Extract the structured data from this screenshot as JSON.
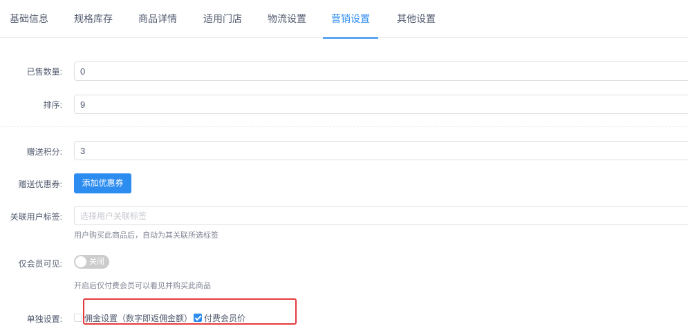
{
  "tabs": [
    {
      "label": "基础信息"
    },
    {
      "label": "规格库存"
    },
    {
      "label": "商品详情"
    },
    {
      "label": "适用门店"
    },
    {
      "label": "物流设置"
    },
    {
      "label": "营销设置",
      "active": true
    },
    {
      "label": "其他设置"
    }
  ],
  "form": {
    "sold_count": {
      "label": "已售数量:",
      "value": "0"
    },
    "sort": {
      "label": "排序:",
      "value": "9"
    },
    "gift_points": {
      "label": "赠送积分:",
      "value": "3"
    },
    "gift_coupon": {
      "label": "赠送优惠券:",
      "button": "添加优惠券"
    },
    "user_tags": {
      "label": "关联用户标签:",
      "placeholder": "选择用户关联标签",
      "help": "用户购买此商品后，自动为其关联所选标签"
    },
    "members_only": {
      "label": "仅会员可见:",
      "switch_text": "关闭",
      "enabled": false,
      "help": "开启后仅付费会员可以看见并购买此商品"
    },
    "individual": {
      "label": "单独设置:",
      "options": [
        {
          "label": "佣金设置（数字即返佣金额）",
          "checked": false
        },
        {
          "label": "付费会员价",
          "checked": true
        }
      ]
    }
  },
  "colors": {
    "accent": "#2d8cf0",
    "highlight": "#e4393c"
  }
}
